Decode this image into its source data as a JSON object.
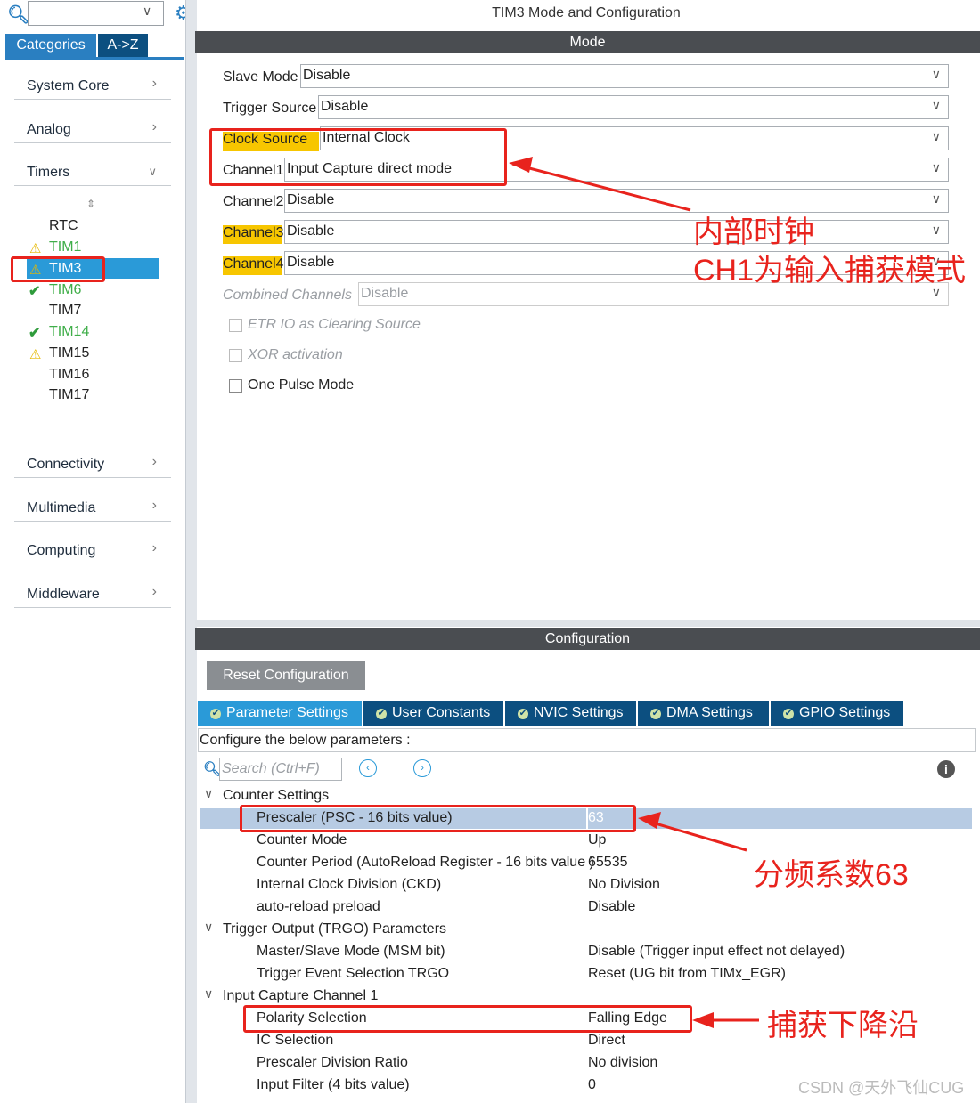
{
  "sidebar": {
    "search_value": "",
    "tabs": [
      "Categories",
      "A->Z"
    ],
    "categories": [
      "System Core",
      "Analog",
      "Timers",
      "Connectivity",
      "Multimedia",
      "Computing",
      "Middleware"
    ],
    "timers": [
      "RTC",
      "TIM1",
      "TIM3",
      "TIM6",
      "TIM7",
      "TIM14",
      "TIM15",
      "TIM16",
      "TIM17"
    ]
  },
  "header": {
    "title": "TIM3 Mode and Configuration"
  },
  "mode": {
    "bar_label": "Mode",
    "slave_mode": {
      "label": "Slave Mode",
      "value": "Disable"
    },
    "trigger_source": {
      "label": "Trigger Source",
      "value": "Disable"
    },
    "clock_source": {
      "label": "Clock Source",
      "value": "Internal Clock"
    },
    "channel1": {
      "label": "Channel1",
      "value": "Input Capture direct mode"
    },
    "channel2": {
      "label": "Channel2",
      "value": "Disable"
    },
    "channel3": {
      "label": "Channel3",
      "value": "Disable"
    },
    "channel4": {
      "label": "Channel4",
      "value": "Disable"
    },
    "combined": {
      "label": "Combined Channels",
      "value": "Disable"
    },
    "etr": "ETR IO as Clearing Source",
    "xor": "XOR activation",
    "one_pulse": "One Pulse Mode"
  },
  "config": {
    "bar_label": "Configuration",
    "reset_button": "Reset Configuration",
    "tabs": [
      "Parameter Settings",
      "User Constants",
      "NVIC Settings",
      "DMA Settings",
      "GPIO Settings"
    ],
    "hint": "Configure the below parameters :",
    "search_placeholder": "Search (Ctrl+F)",
    "groups": {
      "counter": "Counter Settings",
      "trgo": "Trigger Output (TRGO) Parameters",
      "ic1": "Input Capture Channel 1"
    },
    "params": [
      {
        "name": "Prescaler (PSC - 16 bits value)",
        "value": "63"
      },
      {
        "name": "Counter Mode",
        "value": "Up"
      },
      {
        "name": "Counter Period (AutoReload Register - 16 bits value )",
        "value": "65535"
      },
      {
        "name": "Internal Clock Division (CKD)",
        "value": "No Division"
      },
      {
        "name": "auto-reload preload",
        "value": "Disable"
      },
      {
        "name": "Master/Slave Mode (MSM bit)",
        "value": "Disable (Trigger input effect not delayed)"
      },
      {
        "name": "Trigger Event Selection TRGO",
        "value": "Reset (UG bit from TIMx_EGR)"
      },
      {
        "name": "Polarity Selection",
        "value": "Falling Edge"
      },
      {
        "name": "IC Selection",
        "value": "Direct"
      },
      {
        "name": "Prescaler Division Ratio",
        "value": "No division"
      },
      {
        "name": "Input Filter (4 bits value)",
        "value": "0"
      }
    ]
  },
  "annotations": {
    "clock": "内部时钟",
    "ch1": "CH1为输入捕获模式",
    "psc": "分频系数63",
    "falling": "捕获下降沿"
  },
  "watermark": "CSDN @天外飞仙CUG",
  "colors": {
    "accent": "#2a7fc1",
    "dark_tab": "#0c4f80",
    "highlight": "#f7c600",
    "annotation_red": "#e8231d",
    "header_bar": "#4a4d51"
  }
}
